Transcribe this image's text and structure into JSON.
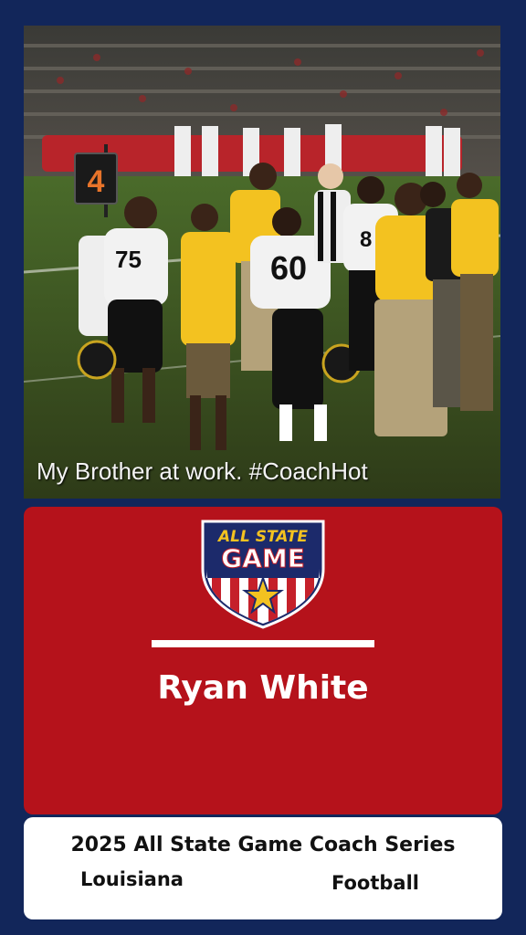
{
  "photo": {
    "caption": "My Brother at work. #CoachHot",
    "sideline_marker": "4",
    "jersey_numbers": [
      "75",
      "60",
      "8"
    ]
  },
  "logo": {
    "line1": "ALL STATE",
    "line2": "GAME",
    "icon": "star-shield-icon"
  },
  "coach": {
    "name": "Ryan White"
  },
  "info": {
    "series": "2025 All State Game Coach Series",
    "state": "Louisiana",
    "sport": "Football"
  },
  "colors": {
    "background": "#12265a",
    "card_red": "#b5121b",
    "gold": "#f3c220",
    "navy": "#1c2a6b"
  }
}
